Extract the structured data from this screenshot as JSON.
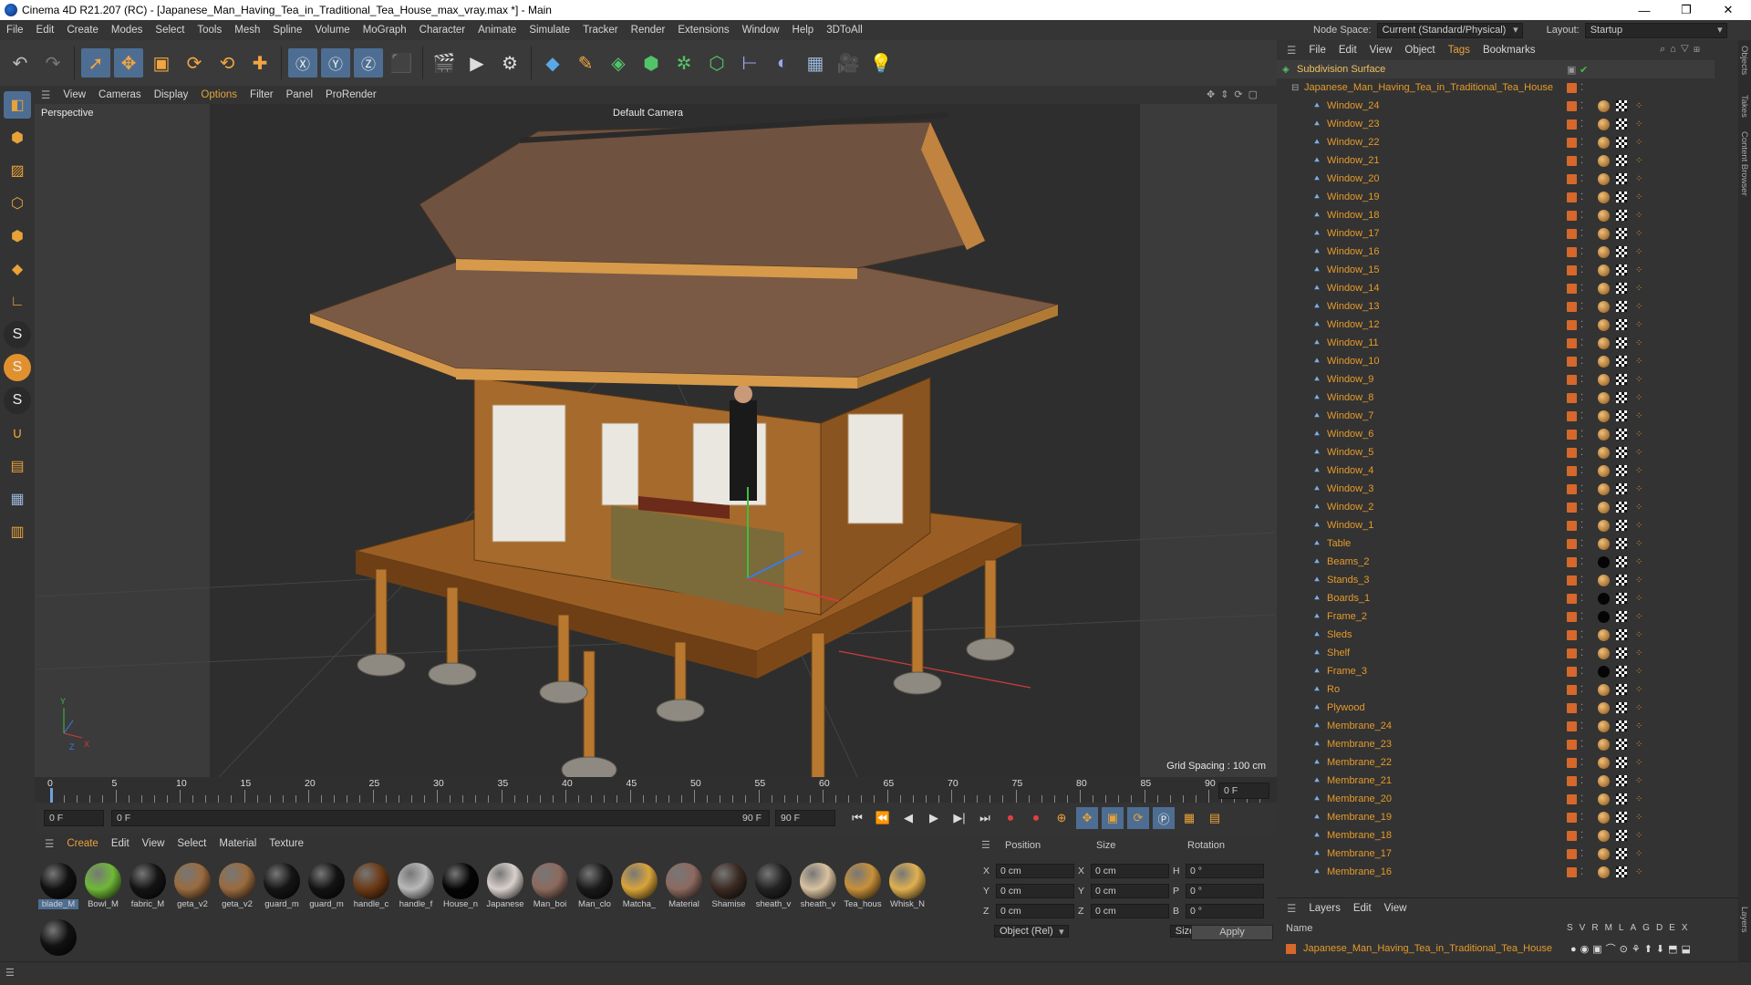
{
  "window": {
    "title": "Cinema 4D R21.207 (RC) - [Japanese_Man_Having_Tea_in_Traditional_Tea_House_max_vray.max *] - Main",
    "min": "—",
    "max": "❐",
    "close": "✕"
  },
  "menu": [
    "File",
    "Edit",
    "Create",
    "Modes",
    "Select",
    "Tools",
    "Mesh",
    "Spline",
    "Volume",
    "MoGraph",
    "Character",
    "Animate",
    "Simulate",
    "Tracker",
    "Render",
    "Extensions",
    "Window",
    "Help",
    "3DToAll"
  ],
  "nodespace": {
    "label": "Node Space:",
    "value": "Current (Standard/Physical)",
    "layout_label": "Layout:",
    "layout_value": "Startup"
  },
  "viewport": {
    "menu": [
      "View",
      "Cameras",
      "Display",
      "Options",
      "Filter",
      "Panel",
      "ProRender"
    ],
    "label": "Perspective",
    "camera": "Default Camera",
    "grid_spacing": "Grid Spacing : 100 cm",
    "axis_y": "Y",
    "axis_z": "Z",
    "axis_x": "X"
  },
  "timeline": {
    "ticks": [
      "0",
      "5",
      "10",
      "15",
      "20",
      "25",
      "30",
      "35",
      "40",
      "45",
      "50",
      "55",
      "60",
      "65",
      "70",
      "75",
      "80",
      "85",
      "90"
    ],
    "current_frame": "0 F",
    "start": "0 F",
    "range_start": "0 F",
    "range_end": "90 F",
    "end": "90 F"
  },
  "materials": {
    "menu": [
      "Create",
      "Edit",
      "View",
      "Select",
      "Material",
      "Texture"
    ],
    "items": [
      {
        "label": "blade_M",
        "color": "#111111"
      },
      {
        "label": "Bowl_M",
        "color": "#6fb838"
      },
      {
        "label": "fabric_M",
        "color": "#141414"
      },
      {
        "label": "geta_v2",
        "color": "#9a6b3f"
      },
      {
        "label": "geta_v2",
        "color": "#9a6b3f"
      },
      {
        "label": "guard_m",
        "color": "#151515"
      },
      {
        "label": "guard_m",
        "color": "#131313"
      },
      {
        "label": "handle_c",
        "color": "#6b3a16"
      },
      {
        "label": "handle_f",
        "color": "#b8b8b8"
      },
      {
        "label": "House_n",
        "color": "#050505"
      },
      {
        "label": "Japanese",
        "color": "#d8d0cc"
      },
      {
        "label": "Man_boi",
        "color": "#8c6a5e"
      },
      {
        "label": "Man_clo",
        "color": "#1a1a1a"
      },
      {
        "label": "Matcha_",
        "color": "#d9a43a"
      },
      {
        "label": "Material",
        "color": "#8c6a60"
      },
      {
        "label": "Shamise",
        "color": "#3a2a22"
      },
      {
        "label": "sheath_v",
        "color": "#222222"
      },
      {
        "label": "sheath_v",
        "color": "#d8c2a0"
      },
      {
        "label": "Tea_hous",
        "color": "#c8903a"
      },
      {
        "label": "Whisk_N",
        "color": "#e0b050"
      },
      {
        "label": "",
        "color": "#111111"
      }
    ]
  },
  "coords": {
    "headers": [
      "Position",
      "Size",
      "Rotation"
    ],
    "rows": [
      {
        "axis": "X",
        "pos": "0 cm",
        "saxis": "X",
        "size": "0 cm",
        "raxis": "H",
        "rot": "0 °"
      },
      {
        "axis": "Y",
        "pos": "0 cm",
        "saxis": "Y",
        "size": "0 cm",
        "raxis": "P",
        "rot": "0 °"
      },
      {
        "axis": "Z",
        "pos": "0 cm",
        "saxis": "Z",
        "size": "0 cm",
        "raxis": "B",
        "rot": "0 °"
      }
    ],
    "mode": "Object (Rel)",
    "size_mode": "Size",
    "apply": "Apply"
  },
  "objects": {
    "menu": [
      "File",
      "Edit",
      "View",
      "Object",
      "Tags",
      "Bookmarks"
    ],
    "root": "Subdivision Surface",
    "group": "Japanese_Man_Having_Tea_in_Traditional_Tea_House",
    "items": [
      "Window_24",
      "Window_23",
      "Window_22",
      "Window_21",
      "Window_20",
      "Window_19",
      "Window_18",
      "Window_17",
      "Window_16",
      "Window_15",
      "Window_14",
      "Window_13",
      "Window_12",
      "Window_11",
      "Window_10",
      "Window_9",
      "Window_8",
      "Window_7",
      "Window_6",
      "Window_5",
      "Window_4",
      "Window_3",
      "Window_2",
      "Window_1",
      "Table",
      "Beams_2",
      "Stands_3",
      "Boards_1",
      "Frame_2",
      "Sleds",
      "Shelf",
      "Frame_3",
      "Ro",
      "Plywood",
      "Membrane_24",
      "Membrane_23",
      "Membrane_22",
      "Membrane_21",
      "Membrane_20",
      "Membrane_19",
      "Membrane_18",
      "Membrane_17",
      "Membrane_16"
    ]
  },
  "layers": {
    "menu": [
      "Layers",
      "Edit",
      "View"
    ],
    "name_header": "Name",
    "cols": [
      "S",
      "V",
      "R",
      "M",
      "L",
      "A",
      "G",
      "D",
      "E",
      "X"
    ],
    "row": "Japanese_Man_Having_Tea_in_Traditional_Tea_House"
  },
  "right_tabs": [
    "Objects",
    "Takes",
    "Content Browser",
    "Layers"
  ],
  "colors": {
    "accent": "#4d6e92",
    "object_text": "#e59a2a",
    "tag_orange": "#d5682a"
  }
}
